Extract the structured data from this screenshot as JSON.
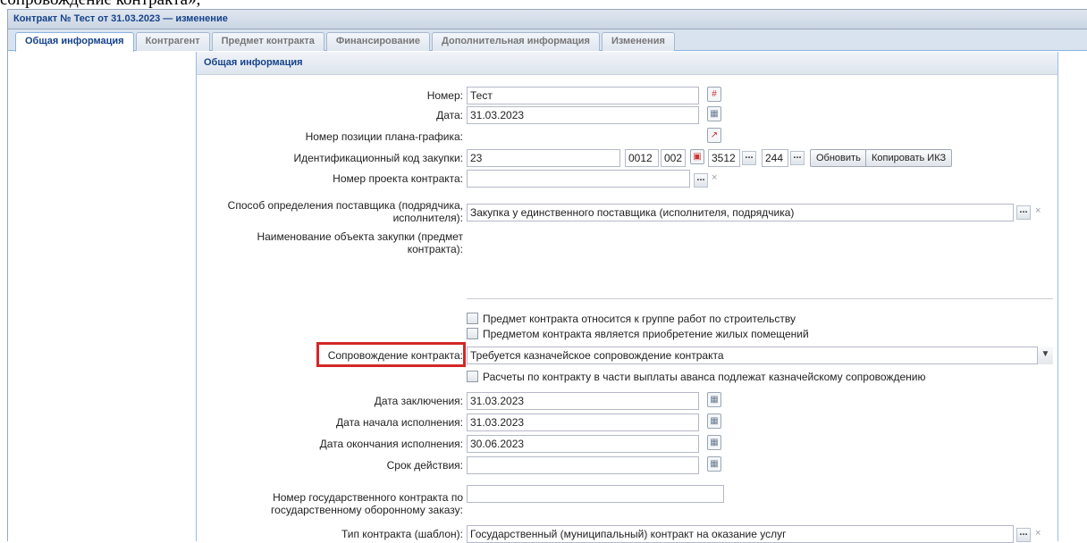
{
  "window": {
    "title": "Контракт № Тест от 31.03.2023 — изменение",
    "top_text": "сопровождение контракта»,"
  },
  "tabs": [
    {
      "label": "Общая информация",
      "active": true
    },
    {
      "label": "Контрагент"
    },
    {
      "label": "Предмет контракта"
    },
    {
      "label": "Финансирование"
    },
    {
      "label": "Дополнительная информация"
    },
    {
      "label": "Изменения"
    }
  ],
  "panel": {
    "title": "Общая информация"
  },
  "form": {
    "number_label": "Номер:",
    "number_value": "Тест",
    "date_label": "Дата:",
    "date_value": "31.03.2023",
    "plan_pos_label": "Номер позиции плана-графика:",
    "ikz_label": "Идентификационный код закупки:",
    "ikz_part1": "23",
    "ikz_part2": "0012",
    "ikz_part3": "002",
    "ikz_part4": "3512",
    "ikz_part5": "244",
    "refresh_button": "Обновить",
    "copy_ikz_button": "Копировать ИКЗ",
    "project_number_label": "Номер проекта контракта:",
    "supplier_method_label_1": "Способ определения поставщика (подрядчика,",
    "supplier_method_label_2": "исполнителя):",
    "supplier_method_value": "Закупка у единственного поставщика (исполнителя, подрядчика)",
    "object_name_label_1": "Наименование объекта закупки (предмет",
    "object_name_label_2": "контракта):",
    "construction_checkbox": "Предмет контракта относится к группе работ по строительству",
    "housing_checkbox": "Предметом контракта является приобретение жилых помещений",
    "support_label": "Сопровождение контракта:",
    "support_value": "Требуется казначейское сопровождение контракта",
    "advance_checkbox": "Расчеты по контракту в части выплаты аванса подлежат казначейскому сопровождению",
    "conclusion_date_label": "Дата заключения:",
    "conclusion_date_value": "31.03.2023",
    "start_date_label": "Дата начала исполнения:",
    "start_date_value": "31.03.2023",
    "end_date_label": "Дата окончания исполнения:",
    "end_date_value": "30.06.2023",
    "validity_label": "Срок действия:",
    "gov_number_label_1": "Номер государственного контракта по",
    "gov_number_label_2": "государственному оборонному заказу:",
    "contract_type_label": "Тип контракта (шаблон):",
    "contract_type_value": "Государственный (муниципальный) контракт на оказание услуг"
  },
  "colors": {
    "highlight": "#d32727",
    "title_blue": "#15428b"
  }
}
